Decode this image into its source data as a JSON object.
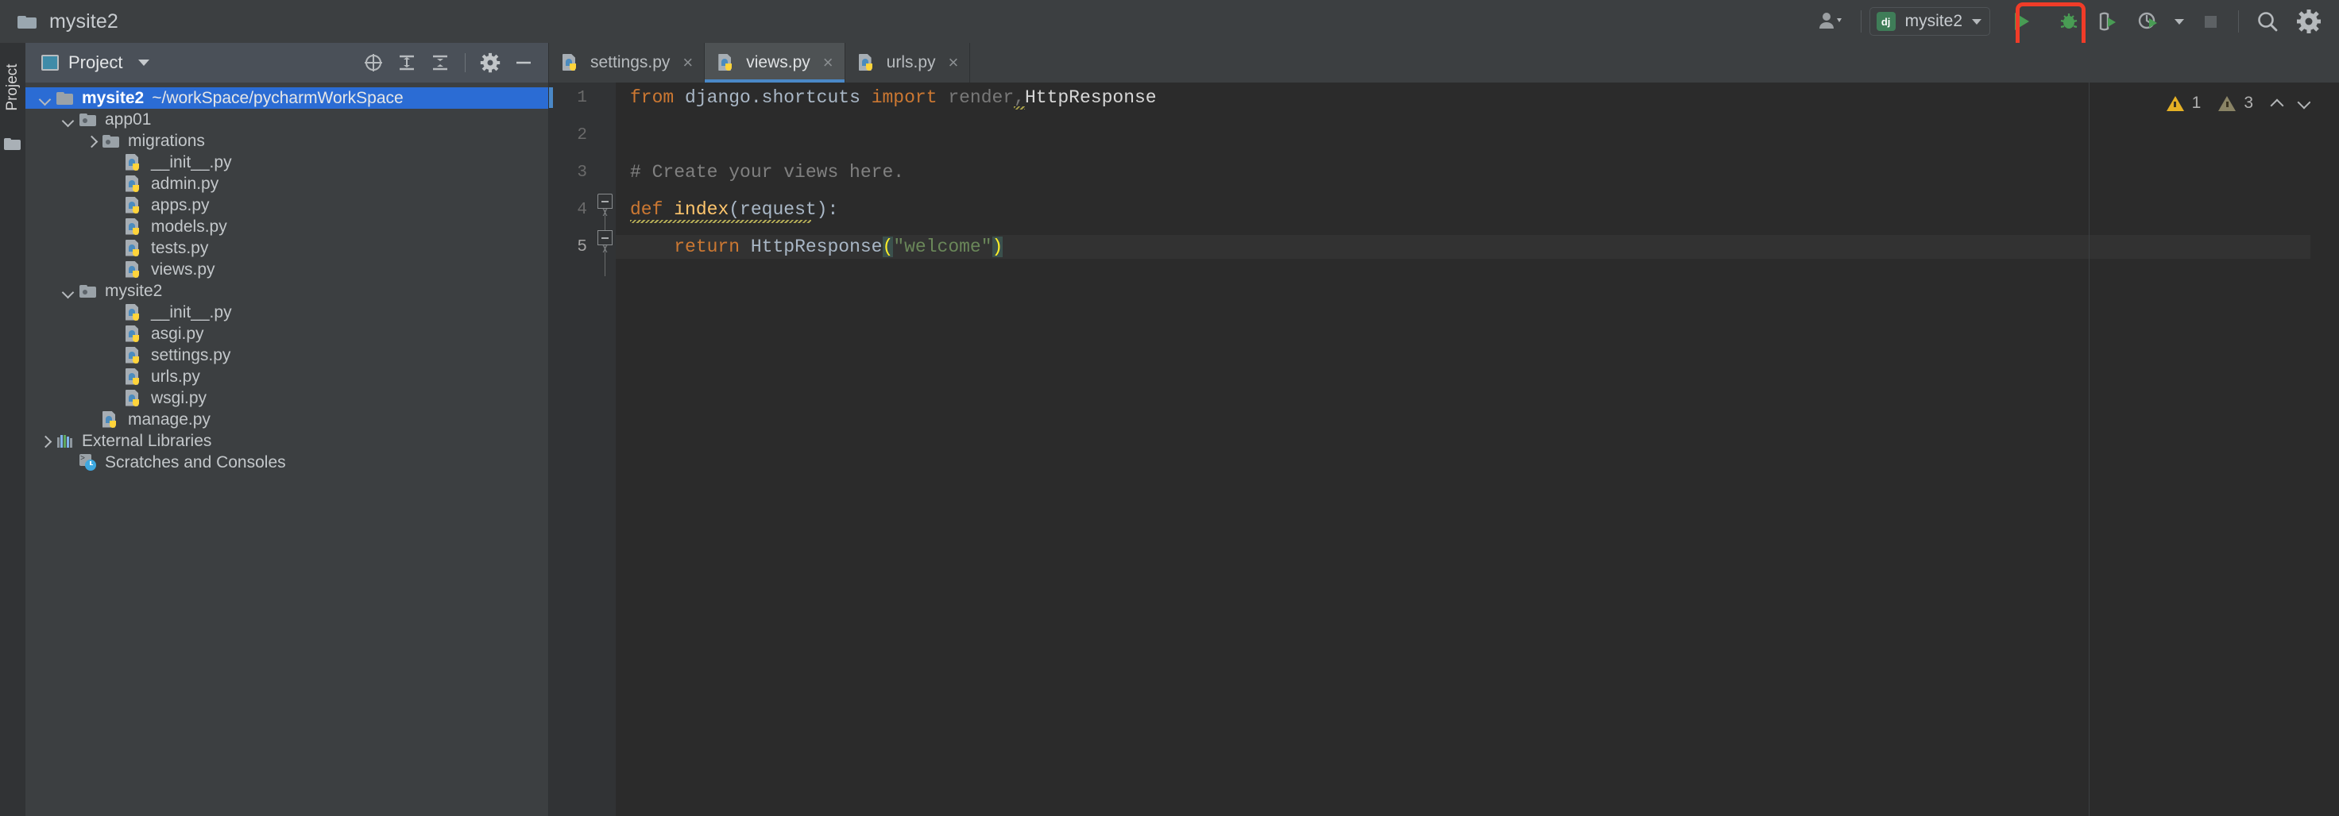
{
  "window": {
    "title": "mysite2",
    "folder_icon": "folder-icon"
  },
  "titlebar_right": {
    "account_icon": "user-account-icon",
    "run_config": {
      "icon": "django-icon",
      "icon_label": "dj",
      "name": "mysite2",
      "caret": "chevron-down-icon"
    },
    "run_button": "run-icon",
    "debug_button": "debug-icon",
    "coverage_button": "run-with-coverage-icon",
    "profile_button": "profile-icon",
    "profile_caret": "chevron-down-icon",
    "stop_button": "stop-icon",
    "search_button": "search-everywhere-icon",
    "settings_button": "gear-icon",
    "highlight_color": "#f03c28"
  },
  "left_strip": {
    "vertical_tab_label": "Project",
    "folder_icon": "folder-icon"
  },
  "project_panel": {
    "header": {
      "icon": "project-view-icon",
      "label": "Project",
      "caret": "chevron-down-icon",
      "tools": [
        {
          "name": "select-opened-file-icon"
        },
        {
          "name": "expand-all-icon"
        },
        {
          "name": "collapse-all-icon"
        },
        {
          "name": "settings-gear-icon"
        },
        {
          "name": "hide-icon"
        }
      ]
    },
    "tree": [
      {
        "label": "mysite2",
        "path": "~/workSpace/pycharmWorkSpace",
        "icon": "folder",
        "arrow": "down",
        "indent": 0,
        "selected": true
      },
      {
        "label": "app01",
        "path": "",
        "icon": "pkg",
        "arrow": "down",
        "indent": 1,
        "selected": false
      },
      {
        "label": "migrations",
        "path": "",
        "icon": "pkg",
        "arrow": "right",
        "indent": 2,
        "selected": false
      },
      {
        "label": "__init__.py",
        "path": "",
        "icon": "py",
        "arrow": "none",
        "indent": 3,
        "selected": false
      },
      {
        "label": "admin.py",
        "path": "",
        "icon": "py",
        "arrow": "none",
        "indent": 3,
        "selected": false
      },
      {
        "label": "apps.py",
        "path": "",
        "icon": "py",
        "arrow": "none",
        "indent": 3,
        "selected": false
      },
      {
        "label": "models.py",
        "path": "",
        "icon": "py",
        "arrow": "none",
        "indent": 3,
        "selected": false
      },
      {
        "label": "tests.py",
        "path": "",
        "icon": "py",
        "arrow": "none",
        "indent": 3,
        "selected": false
      },
      {
        "label": "views.py",
        "path": "",
        "icon": "py",
        "arrow": "none",
        "indent": 3,
        "selected": false
      },
      {
        "label": "mysite2",
        "path": "",
        "icon": "pkg",
        "arrow": "down",
        "indent": 1,
        "selected": false
      },
      {
        "label": "__init__.py",
        "path": "",
        "icon": "py",
        "arrow": "none",
        "indent": 3,
        "selected": false
      },
      {
        "label": "asgi.py",
        "path": "",
        "icon": "py",
        "arrow": "none",
        "indent": 3,
        "selected": false
      },
      {
        "label": "settings.py",
        "path": "",
        "icon": "py",
        "arrow": "none",
        "indent": 3,
        "selected": false
      },
      {
        "label": "urls.py",
        "path": "",
        "icon": "py",
        "arrow": "none",
        "indent": 3,
        "selected": false
      },
      {
        "label": "wsgi.py",
        "path": "",
        "icon": "py",
        "arrow": "none",
        "indent": 3,
        "selected": false
      },
      {
        "label": "manage.py",
        "path": "",
        "icon": "py",
        "arrow": "none",
        "indent": 2,
        "selected": false
      },
      {
        "label": "External Libraries",
        "path": "",
        "icon": "libs",
        "arrow": "right",
        "indent": 0,
        "selected": false
      },
      {
        "label": "Scratches and Consoles",
        "path": "",
        "icon": "scr",
        "arrow": "none",
        "indent": 1,
        "selected": false
      }
    ]
  },
  "editor": {
    "tabs": [
      {
        "label": "settings.py",
        "icon": "python-file-icon",
        "close": "×",
        "active": false
      },
      {
        "label": "views.py",
        "icon": "python-file-icon",
        "close": "×",
        "active": true
      },
      {
        "label": "urls.py",
        "icon": "python-file-icon",
        "close": "×",
        "active": false
      }
    ],
    "line_numbers": [
      "1",
      "2",
      "3",
      "4",
      "5"
    ],
    "current_line": 5,
    "lines": [
      {
        "n": "1",
        "tokens": [
          {
            "t": "from",
            "c": "kw"
          },
          {
            "t": " ",
            "c": "plain"
          },
          {
            "t": "django.shortcuts",
            "c": "plain"
          },
          {
            "t": " ",
            "c": "plain"
          },
          {
            "t": "import",
            "c": "kw"
          },
          {
            "t": " ",
            "c": "plain"
          },
          {
            "t": "render",
            "c": "dim"
          },
          {
            "t": ",",
            "c": "sqdim"
          },
          {
            "t": "HttpResponse",
            "c": "white"
          }
        ]
      },
      {
        "n": "2",
        "tokens": []
      },
      {
        "n": "3",
        "tokens": [
          {
            "t": "# Create your views here.",
            "c": "cmt"
          }
        ]
      },
      {
        "n": "4",
        "tokens": [
          {
            "t": "def",
            "c": "kw"
          },
          {
            "t": " ",
            "c": "plain"
          },
          {
            "t": "index",
            "c": "fnname"
          },
          {
            "t": "(request):",
            "c": "plain"
          }
        ]
      },
      {
        "n": "5",
        "tokens": [
          {
            "t": "    ",
            "c": "plain"
          },
          {
            "t": "return",
            "c": "kw"
          },
          {
            "t": " ",
            "c": "plain"
          },
          {
            "t": "HttpResponse",
            "c": "plain"
          },
          {
            "t": "(",
            "c": "brace"
          },
          {
            "t": "\"welcome\"",
            "c": "str"
          },
          {
            "t": ")",
            "c": "brace"
          }
        ]
      }
    ],
    "inspections": {
      "warning_icon": "warning-triangle-icon",
      "warning_count": "1",
      "weak_icon": "weak-warning-triangle-icon",
      "weak_count": "3",
      "prev_icon": "chevron-up-icon",
      "next_icon": "chevron-down-icon"
    }
  }
}
